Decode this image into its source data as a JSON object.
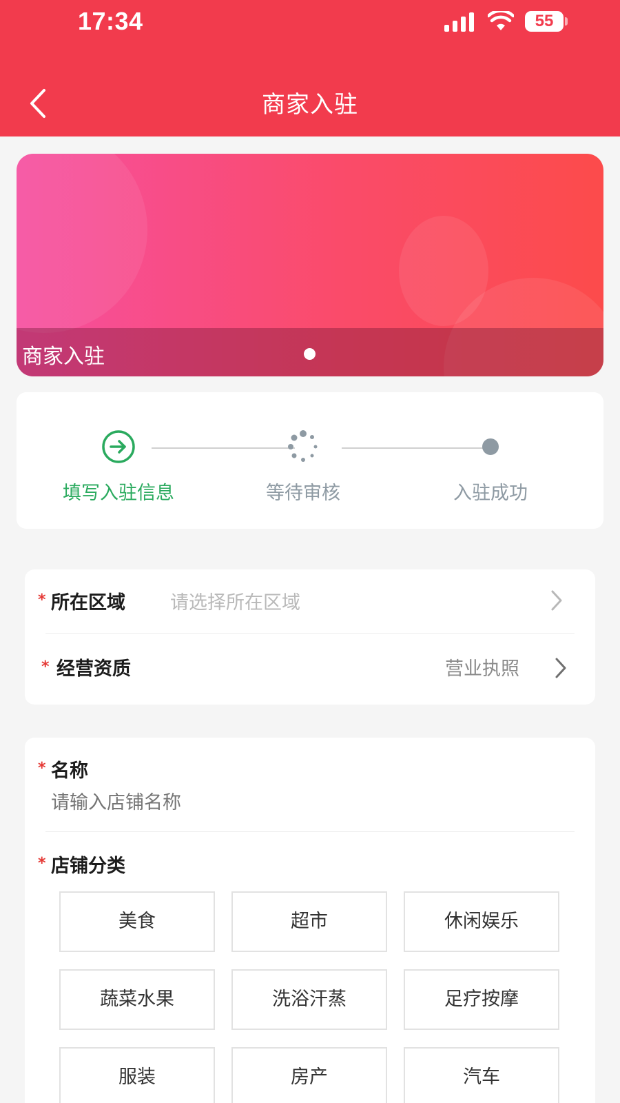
{
  "status_bar": {
    "time": "17:34",
    "battery": "55",
    "icons": [
      "signal-icon",
      "wifi-icon",
      "battery-icon"
    ]
  },
  "nav": {
    "title": "商家入驻",
    "back_icon": "chevron-left-icon"
  },
  "banner": {
    "caption": "商家入驻"
  },
  "steps": [
    {
      "label": "填写入驻信息",
      "state": "active",
      "icon": "arrow-right-circle-icon"
    },
    {
      "label": "等待审核",
      "state": "pending",
      "icon": "loading-spinner-icon"
    },
    {
      "label": "入驻成功",
      "state": "pending",
      "icon": "dot-icon"
    }
  ],
  "region_card": {
    "region": {
      "label": "所在区域",
      "placeholder": "请选择所在区域"
    },
    "qualification": {
      "label": "经营资质",
      "value": "营业执照"
    }
  },
  "store_card": {
    "name": {
      "label": "名称",
      "placeholder": "请输入店铺名称"
    },
    "category": {
      "label": "店铺分类",
      "options": [
        "美食",
        "超市",
        "休闲娱乐",
        "蔬菜水果",
        "洗浴汗蒸",
        "足疗按摩",
        "服装",
        "房产",
        "汽车"
      ]
    }
  },
  "colors": {
    "brand_red": "#f23b4d",
    "step_active_green": "#2aaa5e",
    "step_inactive_gray": "#8e9aa3",
    "required_star": "#e53935"
  }
}
